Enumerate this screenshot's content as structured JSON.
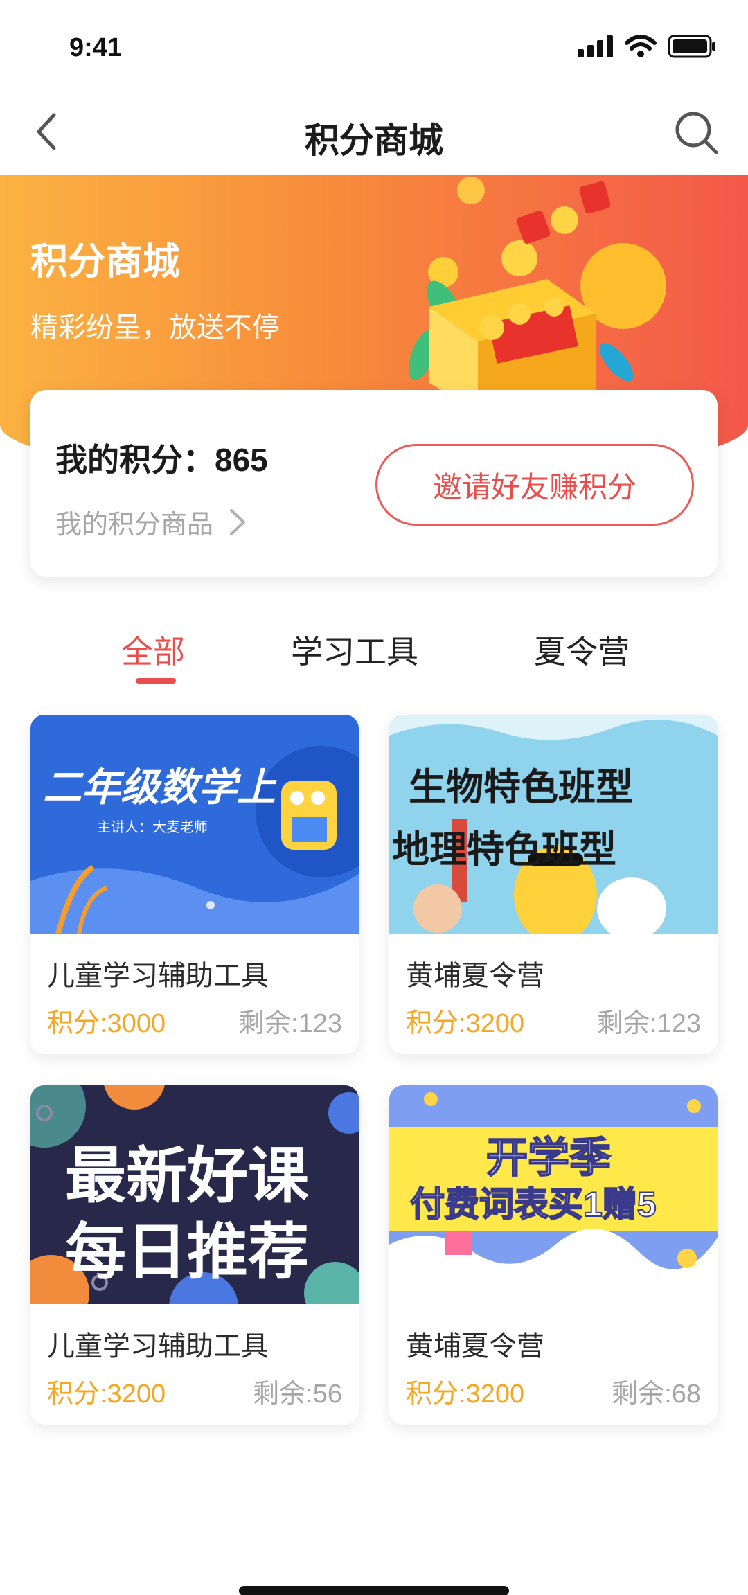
{
  "status_bar": {
    "time": "9:41"
  },
  "nav": {
    "title": "积分商城"
  },
  "banner": {
    "title": "积分商城",
    "subtitle": "精彩纷呈，放送不停"
  },
  "points": {
    "label": "我的积分：",
    "value": "865",
    "my_goods_link": "我的积分商品",
    "invite_button": "邀请好友赚积分"
  },
  "tabs": [
    {
      "label": "全部",
      "active": true
    },
    {
      "label": "学习工具",
      "active": false
    },
    {
      "label": "夏令营",
      "active": false
    }
  ],
  "products": [
    {
      "name": "儿童学习辅助工具",
      "price": "积分:3000",
      "stock": "剩余:123",
      "image_text": [
        "二年级数学上",
        "主讲人：大麦老师"
      ]
    },
    {
      "name": "黄埔夏令营",
      "price": "积分:3200",
      "stock": "剩余:123",
      "image_text": [
        "生物特色班型",
        "地理特色班型"
      ]
    },
    {
      "name": "儿童学习辅助工具",
      "price": "积分:3200",
      "stock": "剩余:56",
      "image_text": [
        "最新好课",
        "每日推荐"
      ]
    },
    {
      "name": "黄埔夏令营",
      "price": "积分:3200",
      "stock": "剩余:68",
      "image_text": [
        "开学季",
        "付费词表买1赠5"
      ]
    }
  ],
  "colors": {
    "accent": "#e84e4b",
    "price": "#f5a623",
    "banner_start": "#fbb242",
    "banner_end": "#f3584a"
  },
  "icons": [
    "back-icon",
    "search-icon",
    "signal-icon",
    "wifi-icon",
    "battery-icon",
    "chevron-right-icon"
  ]
}
